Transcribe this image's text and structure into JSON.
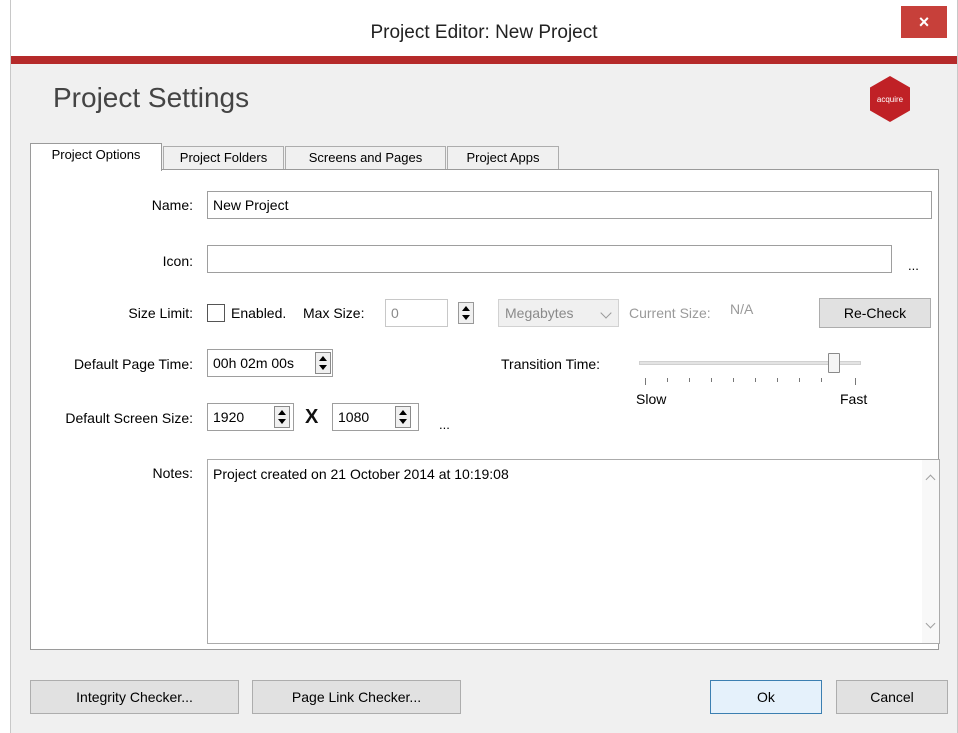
{
  "window": {
    "title": "Project Editor: New Project",
    "close_glyph": "×",
    "accent_color": "#b52a2a"
  },
  "header": {
    "title": "Project Settings",
    "logo_text": "acquire"
  },
  "tabs": [
    {
      "label": "Project Options",
      "active": true
    },
    {
      "label": "Project Folders",
      "active": false
    },
    {
      "label": "Screens and Pages",
      "active": false
    },
    {
      "label": "Project Apps",
      "active": false
    }
  ],
  "form": {
    "name_label": "Name:",
    "name_value": "New Project",
    "icon_label": "Icon:",
    "icon_value": "",
    "icon_browse": "...",
    "size_limit_label": "Size Limit:",
    "enabled_label": "Enabled.",
    "enabled_checked": false,
    "max_size_label": "Max Size:",
    "max_size_value": "0",
    "unit_value": "Megabytes",
    "current_size_label": "Current Size:",
    "current_size_value": "N/A",
    "recheck_label": "Re-Check",
    "page_time_label": "Default Page Time:",
    "page_time_value": "00h 02m 00s",
    "transition_label": "Transition Time:",
    "transition_slow": "Slow",
    "transition_fast": "Fast",
    "transition_level": 0.9,
    "screen_size_label": "Default Screen Size:",
    "screen_width": "1920",
    "screen_x": "X",
    "screen_height": "1080",
    "screen_more": "...",
    "notes_label": "Notes:",
    "notes_value": "Project created on 21 October 2014 at 10:19:08"
  },
  "footer": {
    "integrity_label": "Integrity Checker...",
    "pagelink_label": "Page Link Checker...",
    "ok_label": "Ok",
    "cancel_label": "Cancel"
  }
}
